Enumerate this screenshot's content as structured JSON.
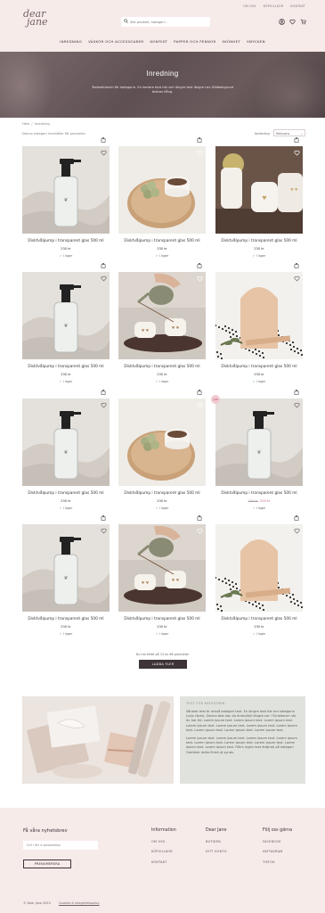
{
  "header": {
    "top_links": [
      "Om oss",
      "Köpvillkor",
      "Kontakt"
    ],
    "logo_line1": "dear",
    "logo_line2": "jane",
    "search_placeholder": "Sök produkt, kategori...",
    "icons": [
      "user-icon",
      "heart-icon",
      "cart-icon"
    ],
    "nav": [
      "Inredning",
      "Väskor och accessoarer",
      "Konfekt",
      "Papper och pennor",
      "Skönhet",
      "Smycken"
    ]
  },
  "hero": {
    "title": "Inredning",
    "text": "Textsektionen för kategorin. En kortare text här och längre text längre ner. Bildbakgrund ändras ifång."
  },
  "toolbar": {
    "breadcrumb": [
      "Hem",
      "Inredning"
    ],
    "results": "Denna kategori innehåller 66 produkter",
    "sort_label": "Sortering",
    "sort_value": "Relevans"
  },
  "products": [
    {
      "name": "Disktvålpump i transparent glas 500 ml",
      "price": "230 kr",
      "stock": "I lager",
      "img": "pump"
    },
    {
      "name": "Disktvålpump i transparent glas 500 ml",
      "price": "230 kr",
      "stock": "I lager",
      "img": "cup"
    },
    {
      "name": "Disktvålpump i transparent glas 500 ml",
      "price": "230 kr",
      "stock": "I lager",
      "img": "mugs"
    },
    {
      "name": "Disktvålpump i transparent glas 500 ml",
      "price": "230 kr",
      "stock": "I lager",
      "img": "pump"
    },
    {
      "name": "Disktvålpump i transparent glas 500 ml",
      "price": "230 kr",
      "stock": "I lager",
      "img": "teapot"
    },
    {
      "name": "Disktvålpump i transparent glas 500 ml",
      "price": "230 kr",
      "stock": "I lager",
      "img": "stand"
    },
    {
      "name": "Disktvålpump i transparent glas 500 ml",
      "price": "230 kr",
      "stock": "I lager",
      "img": "pump"
    },
    {
      "name": "Disktvålpump i transparent glas 500 ml",
      "price": "230 kr",
      "stock": "I lager",
      "img": "cup"
    },
    {
      "name": "Disktvålpump i transparent glas 500 ml",
      "price_old": "230 kr",
      "price": "200 kr",
      "stock": "I lager",
      "img": "pump",
      "badge": "-13%"
    },
    {
      "name": "Disktvålpump i transparent glas 500 ml",
      "price": "230 kr",
      "stock": "I lager",
      "img": "pump"
    },
    {
      "name": "Disktvålpump i transparent glas 500 ml",
      "price": "230 kr",
      "stock": "I lager",
      "img": "teapot"
    },
    {
      "name": "Disktvålpump i transparent glas 500 ml",
      "price": "230 kr",
      "stock": "I lager",
      "img": "stand"
    }
  ],
  "pagination": {
    "text": "Du har tittat på 12 av 66 produkter",
    "button": "Ladda fler"
  },
  "editorial": {
    "kicker": "Text för kategorin",
    "p1": "Vänster text är också kategori text. En längre text här om kategorin (valv räckt). Denna text kan du ändra/fyll längre ner i Funktioner när du har tid. Lorem ipsum text. Lorem ipsum text. Lorem ipsum text. Lorem ipsum text. Lorem ipsum text. Lorem ipsum text. Lorem ipsum text. Lorem ipsum text. Lorem ipsum text. Lorem ipsum text.",
    "p2": "Lorem ipsum text. Lorem ipsum text. Lorem ipsum text. Lorem ipsum text. Lorem ipsum text. Lorem ipsum text. Lorem ipsum text. Lorem ipsum text. Lorem ipsum text. Föllrs ingen text ärigheti på kategori Gomther delta finish ej synes."
  },
  "footer": {
    "newsletter_title": "Få våra nyhetsbrev",
    "newsletter_placeholder": "Fyll i din e-postadress",
    "newsletter_button": "Prenumerera",
    "cols": [
      {
        "title": "Information",
        "links": [
          "Om oss",
          "Köpvillkor",
          "Kontakt"
        ]
      },
      {
        "title": "Dear Jane",
        "links": [
          "Butiken",
          "Ditt konto"
        ]
      },
      {
        "title": "Följ oss gärna",
        "links": [
          "Facebook",
          "Instagram",
          "Tiktok"
        ]
      }
    ],
    "copyright": "© Dear Jane 2023",
    "legal": "Cookies & Integritetspolicy"
  },
  "colors": {
    "header_bg": "#f7ebea",
    "dark": "#3d3439",
    "sale": "#c06a86",
    "in_stock": "#3aa05a"
  }
}
